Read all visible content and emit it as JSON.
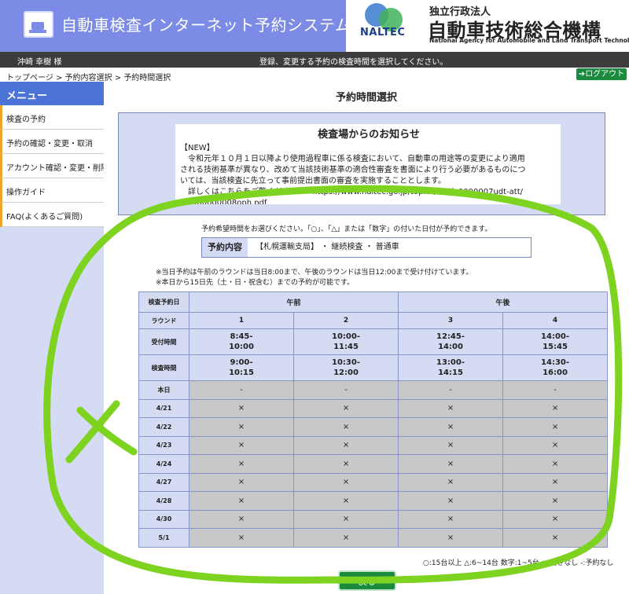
{
  "header": {
    "app_title": "自動車検査インターネット予約システム",
    "brand_mark": "NALTEC",
    "brand_sub": "独立行政法人",
    "brand_name": "自動車技術総合機構",
    "brand_en": "National Agency for Automobile and Land Transport Technology"
  },
  "statusbar": {
    "user": "沖崎 幸樹 様",
    "message": "登録、変更する予約の検査時間を選択してください。"
  },
  "breadcrumb": "トップページ > 予約内容選択 > 予約時間選択",
  "logout_label": "ログアウト",
  "sidebar": {
    "header": "メニュー",
    "items": [
      {
        "label": "検査の予約"
      },
      {
        "label": "予約の確認・変更・取消"
      },
      {
        "label": "アカウント確認・変更・削除"
      },
      {
        "label": "操作ガイド"
      },
      {
        "label": "FAQ(よくあるご質問)"
      }
    ]
  },
  "page_title": "予約時間選択",
  "notice": {
    "title": "検査場からのお知らせ",
    "lines": [
      "【NEW】",
      "　令和元年１０月１日以降より使用過程車に係る検査において、自動車の用途等の変更により適用",
      "される技術基準が異なり、改めて当該技術基準の適合性審査を書面により行う必要があるものにつ",
      "いては、当該検査に先立って事前提出書面の審査を実施することとします。",
      "　詳しくはこちらをご覧ください⇒　https://www.naltec.go.jp/topics/fkoifn0000007udt-att/",
      "fkoifn0000008oph.pdf"
    ]
  },
  "instruction": "予約希望時間をお選びください。「○」、「△」または「数字」の付いた日付が予約できます。",
  "reservation": {
    "label": "予約内容",
    "value": "【札幌運輸支局】 ・ 継続検査 ・ 普通車"
  },
  "notes": [
    "※当日予約は午前のラウンドは当日8:00まで、午後のラウンドは当日12:00まで受け付けています。",
    "※本日から15日先（土・日・祝含む）までの予約が可能です。"
  ],
  "schedule": {
    "date_header": "検査予約日",
    "am": "午前",
    "pm": "午後",
    "round_label": "ラウンド",
    "rounds": [
      "1",
      "2",
      "3",
      "4"
    ],
    "reception_label": "受付時間",
    "reception": [
      {
        "from": "8:45-",
        "to": "10:00"
      },
      {
        "from": "10:00-",
        "to": "11:45"
      },
      {
        "from": "12:45-",
        "to": "14:00"
      },
      {
        "from": "14:00-",
        "to": "15:45"
      }
    ],
    "inspection_label": "検査時間",
    "inspection": [
      {
        "from": "9:00-",
        "to": "10:15"
      },
      {
        "from": "10:30-",
        "to": "12:00"
      },
      {
        "from": "13:00-",
        "to": "14:15"
      },
      {
        "from": "14:30-",
        "to": "16:00"
      }
    ],
    "rows": [
      {
        "date": "本日",
        "cells": [
          "-",
          "-",
          "-",
          "-"
        ]
      },
      {
        "date": "4/21",
        "cells": [
          "×",
          "×",
          "×",
          "×"
        ]
      },
      {
        "date": "4/22",
        "cells": [
          "×",
          "×",
          "×",
          "×"
        ]
      },
      {
        "date": "4/23",
        "cells": [
          "×",
          "×",
          "×",
          "×"
        ]
      },
      {
        "date": "4/24",
        "cells": [
          "×",
          "×",
          "×",
          "×"
        ]
      },
      {
        "date": "4/27",
        "cells": [
          "×",
          "×",
          "×",
          "×"
        ]
      },
      {
        "date": "4/28",
        "cells": [
          "×",
          "×",
          "×",
          "×"
        ]
      },
      {
        "date": "4/30",
        "cells": [
          "×",
          "×",
          "×",
          "×"
        ]
      },
      {
        "date": "5/1",
        "cells": [
          "×",
          "×",
          "×",
          "×"
        ]
      }
    ]
  },
  "legend": "○:15台以上 △:6~14台 数字:1~5台 ×:空きなし -:予約なし",
  "back_label": "戻る",
  "colors": {
    "header_bg": "#7c8be6",
    "sidebar_bg": "#d4dbf2",
    "menu_header": "#4b74d6",
    "menu_accent": "#f0a428",
    "button_green": "#1a8a3c",
    "annotation": "#7ed321"
  }
}
